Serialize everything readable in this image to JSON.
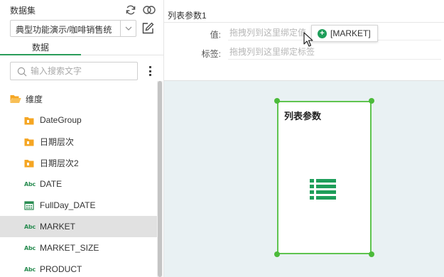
{
  "dataset": {
    "title": "数据集",
    "selected_dataset": "典型功能演示/咖啡销售统",
    "tab_label": "数据",
    "search_placeholder": "输入搜索文字"
  },
  "tree": {
    "root_label": "维度",
    "items": [
      {
        "label": "DateGroup",
        "icon": "folder-icon"
      },
      {
        "label": "日期层次",
        "icon": "folder-icon"
      },
      {
        "label": "日期层次2",
        "icon": "folder-icon"
      },
      {
        "label": "DATE",
        "icon": "abc-icon"
      },
      {
        "label": "FullDay_DATE",
        "icon": "calendar-icon"
      },
      {
        "label": "MARKET",
        "icon": "abc-icon",
        "selected": true
      },
      {
        "label": "MARKET_SIZE",
        "icon": "abc-icon"
      },
      {
        "label": "PRODUCT",
        "icon": "abc-icon"
      }
    ],
    "abc_text": "Abc"
  },
  "properties": {
    "title": "列表参数1",
    "value_label": "值:",
    "value_placeholder": "拖拽列到这里绑定值",
    "tag_label": "标签:",
    "tag_placeholder": "拖拽列到这里绑定标签"
  },
  "drag_chip": {
    "plus": "+",
    "label": "[MARKET]"
  },
  "canvas": {
    "card_title": "列表参数"
  },
  "colors": {
    "accent_green": "#2a9d5a",
    "selection_border": "#5fc44f",
    "folder_orange": "#f5a623",
    "canvas_bg": "#e9f1f3"
  }
}
